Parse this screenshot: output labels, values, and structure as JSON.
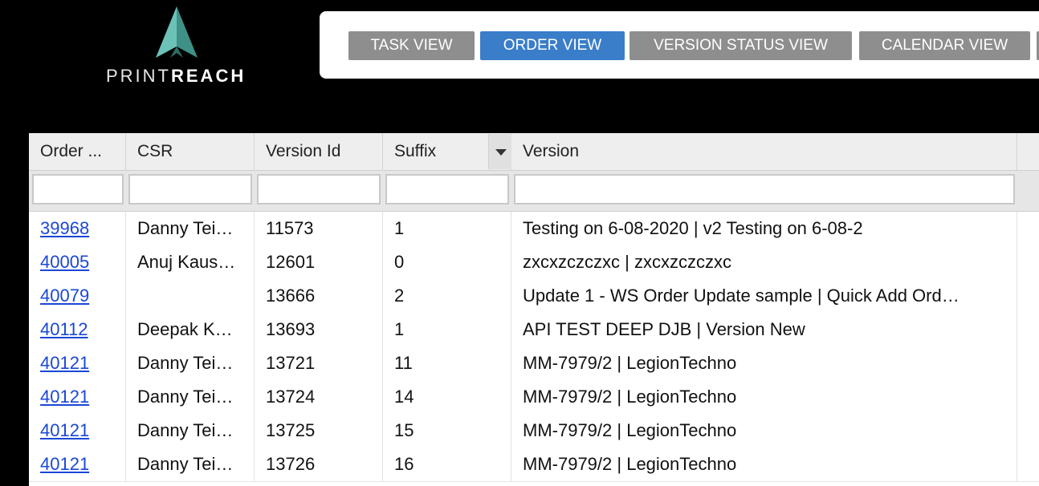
{
  "logo": {
    "text_light": "PRINT",
    "text_bold": "REACH",
    "icon": "paper-plane-logo-icon",
    "colors": {
      "teal": "#5fb3a8",
      "teal_dark": "#3d8c83"
    }
  },
  "views": {
    "task": "TASK VIEW",
    "order": "ORDER VIEW",
    "version_status": "VERSION STATUS VIEW",
    "calendar": "CALENDAR VIEW",
    "active": "ORDER VIEW",
    "colors": {
      "active": "#3a7dc9",
      "inactive": "#8e8e8e"
    }
  },
  "grid": {
    "columns": [
      "Order ...",
      "CSR",
      "Version Id",
      "Suffix",
      "Version"
    ],
    "rows": [
      {
        "order": "39968",
        "csr": "Danny Tei…",
        "version_id": "11573",
        "suffix": "1",
        "version": "Testing on 6-08-2020 | v2 Testing on 6-08-2"
      },
      {
        "order": "40005",
        "csr": "Anuj Kaus…",
        "version_id": "12601",
        "suffix": "0",
        "version": "zxcxzczczxc | zxcxzczczxc"
      },
      {
        "order": "40079",
        "csr": "",
        "version_id": "13666",
        "suffix": "2",
        "version": "Update 1 - WS Order Update sample | Quick Add Ord…"
      },
      {
        "order": "40112",
        "csr": "Deepak K…",
        "version_id": "13693",
        "suffix": "1",
        "version": "API TEST DEEP DJB | Version New"
      },
      {
        "order": "40121",
        "csr": "Danny Tei…",
        "version_id": "13721",
        "suffix": "11",
        "version": "MM-7979/2 | LegionTechno"
      },
      {
        "order": "40121",
        "csr": "Danny Tei…",
        "version_id": "13724",
        "suffix": "14",
        "version": "MM-7979/2 | LegionTechno"
      },
      {
        "order": "40121",
        "csr": "Danny Tei…",
        "version_id": "13725",
        "suffix": "15",
        "version": "MM-7979/2 | LegionTechno"
      },
      {
        "order": "40121",
        "csr": "Danny Tei…",
        "version_id": "13726",
        "suffix": "16",
        "version": "MM-7979/2 | LegionTechno"
      }
    ],
    "link_color": "#1a47d6"
  }
}
